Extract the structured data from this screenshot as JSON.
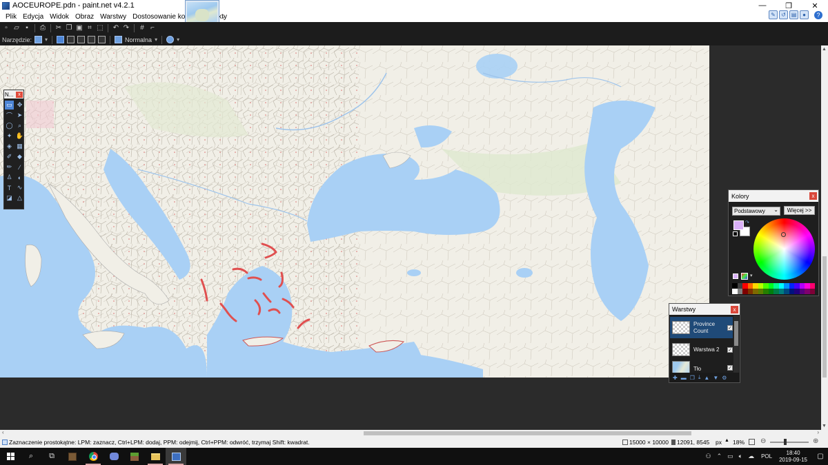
{
  "window": {
    "title": "AOCEUROPE.pdn - paint.net v4.2.1",
    "minimize": "—",
    "maximize": "❐",
    "close": "✕"
  },
  "menu": {
    "items": [
      "Plik",
      "Edycja",
      "Widok",
      "Obraz",
      "Warstwy",
      "Dostosowanie kolorów",
      "Efekty"
    ]
  },
  "toolbar": {
    "tool_label": "Narzędzie:",
    "blend_mode": "Normalna"
  },
  "tools_window": {
    "title": "N...",
    "close": "x"
  },
  "colors_window": {
    "title": "Kolory",
    "close": "x",
    "mode_select": "Podstawowy",
    "more_button": "Więcej >>",
    "primary_color": "#d9b0f7",
    "secondary_color": "#ffffff"
  },
  "layers_window": {
    "title": "Warstwy",
    "close": "x",
    "layers": [
      {
        "name": "Province Count",
        "selected": true,
        "visible": true
      },
      {
        "name": "Warstwa 2",
        "selected": false,
        "visible": true
      },
      {
        "name": "Tło",
        "selected": false,
        "visible": true
      }
    ]
  },
  "status": {
    "message": "Zaznaczenie prostokątne: LPM: zaznacz, Ctrl+LPM: dodaj, PPM: odejmij, Ctrl+PPM: odwróć, trzymaj Shift: kwadrat.",
    "image_size": "15000 × 10000",
    "cursor_pos": "12091, 8545",
    "unit": "px",
    "zoom": "18%"
  },
  "taskbar": {
    "language": "POL",
    "time": "18:40",
    "date": "2019-09-15"
  },
  "colors": {
    "sea": "#a9d0f5",
    "land": "#f1efe7",
    "accent_red": "#e05050",
    "selection_blue": "#4d85d6"
  }
}
